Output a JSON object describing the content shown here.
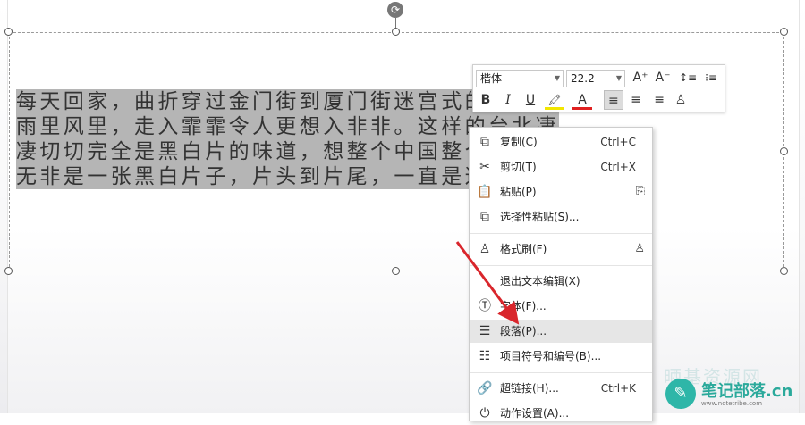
{
  "slide": {
    "text_lines": [
      "每天回家，曲折穿过金门街到厦门街迷宫式的长巷，",
      "雨里风里，走入霏霏令人更想入非非。这样的台北凄",
      "凄切切完全是黑白片的味道，想整个中国整个中国的历史",
      "无非是一张黑白片子，片头到片尾，一直是这么下着雨的。"
    ]
  },
  "mini_toolbar": {
    "font_name": "楷体",
    "font_size": "22.2",
    "grow_font": "A⁺",
    "shrink_font": "A⁻",
    "line_spacing": "↕≡",
    "list_format": "⁝≡",
    "bold": "B",
    "italic": "I",
    "underline": "U",
    "highlight": "🖍",
    "font_color": "A",
    "align_left": "≡",
    "align_center": "≡",
    "align_right": "≡",
    "format_painter": "♙"
  },
  "context_menu": {
    "items": [
      {
        "label": "复制(C)",
        "shortcut": "Ctrl+C",
        "icon": "copy-icon",
        "glyph": "⧉"
      },
      {
        "label": "剪切(T)",
        "shortcut": "Ctrl+X",
        "icon": "scissors-icon",
        "glyph": "✂"
      },
      {
        "label": "粘贴(P)",
        "shortcut": "",
        "icon": "paste-icon",
        "glyph": "📋"
      },
      {
        "label": "选择性粘贴(S)...",
        "shortcut": "",
        "icon": "paste-special-icon",
        "glyph": "⧉"
      },
      {
        "label": "格式刷(F)",
        "shortcut": "",
        "icon": "format-painter-icon",
        "glyph": "♙"
      },
      {
        "label": "退出文本编辑(X)",
        "shortcut": "",
        "icon": "",
        "glyph": ""
      },
      {
        "label": "字体(F)...",
        "shortcut": "",
        "icon": "font-icon",
        "glyph": "Ⓣ"
      },
      {
        "label": "段落(P)...",
        "shortcut": "",
        "icon": "paragraph-icon",
        "glyph": "☰"
      },
      {
        "label": "项目符号和编号(B)...",
        "shortcut": "",
        "icon": "bullets-icon",
        "glyph": "☷"
      },
      {
        "label": "超链接(H)...",
        "shortcut": "Ctrl+K",
        "icon": "link-icon",
        "glyph": "🔗"
      },
      {
        "label": "动作设置(A)...",
        "shortcut": "",
        "icon": "action-icon",
        "glyph": "⏻"
      }
    ]
  },
  "watermark": {
    "title": "笔记部落",
    "suffix": ".cn",
    "url": "www.notetribe.com",
    "faded": "晒基资源网"
  },
  "colors": {
    "selection": "#b5b5b5",
    "annotation_arrow": "#d9262c",
    "font_color_bar": "#e02020",
    "highlight_bar": "#f2e600",
    "watermark": "#2aa99b"
  }
}
